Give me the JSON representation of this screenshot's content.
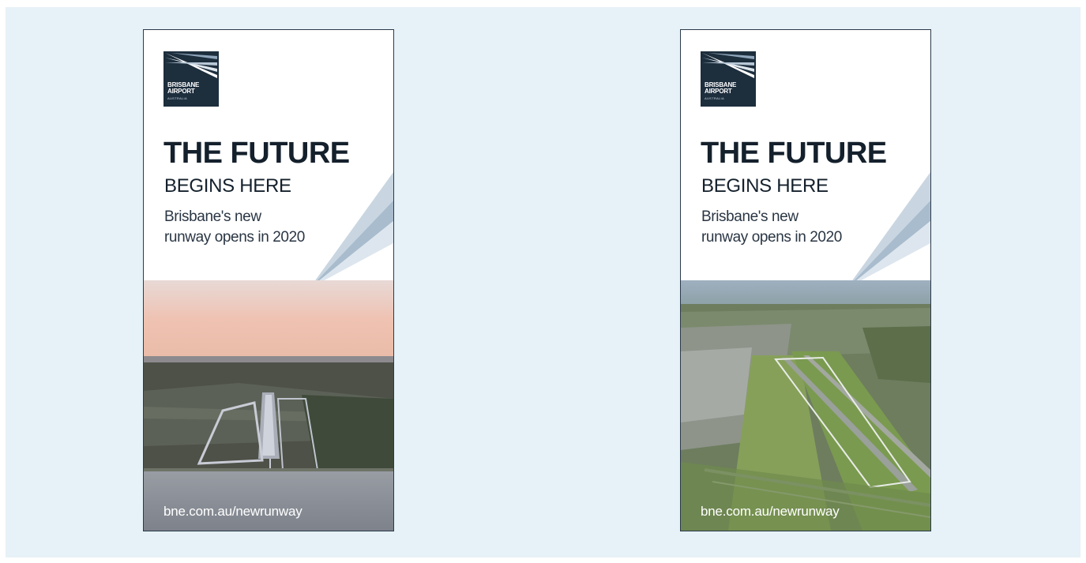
{
  "banners": [
    {
      "logo": {
        "line1": "BRISBANE",
        "line2": "AIRPORT",
        "line3": "AUSTRALIA"
      },
      "headline": "THE FUTURE",
      "subhead": "BEGINS HERE",
      "tagline_line1": "Brisbane's new",
      "tagline_line2": "runway opens in 2020",
      "url": "bne.com.au/newrunway"
    },
    {
      "logo": {
        "line1": "BRISBANE",
        "line2": "AIRPORT",
        "line3": "AUSTRALIA"
      },
      "headline": "THE FUTURE",
      "subhead": "BEGINS HERE",
      "tagline_line1": "Brisbane's new",
      "tagline_line2": "runway opens in 2020",
      "url": "bne.com.au/newrunway"
    }
  ]
}
